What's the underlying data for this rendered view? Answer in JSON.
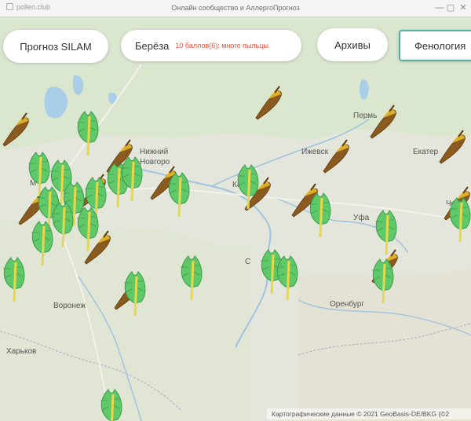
{
  "window": {
    "url": "pollen.club",
    "title": "Онлайн сообщество и АллергоПрогноз",
    "minimize_glyph": "—",
    "restore_glyph": "▢",
    "close_glyph": "✕"
  },
  "controls": {
    "silam_label": "Прогноз SILAM",
    "birch_label": "Берёза",
    "birch_note": "10 баллов(6): много пыльцы",
    "archive_label": "Архивы",
    "phenology_label": "Фенология"
  },
  "map": {
    "cities": {
      "moscow": "М",
      "nizhny1": "Нижний",
      "nizhny2": "Новгоро",
      "kazan": "Казань",
      "perm": "Пермь",
      "izhevsk": "Ижевск",
      "ekaterinburg": "Екатер",
      "ufa": "Уфа",
      "chelyabinsk": "Челя",
      "samara": "С",
      "voronezh": "Воронеж",
      "orenburg": "Оренбург",
      "kharkiv": "Харьков"
    },
    "attribution": "Картографические данные © 2021 GeoBasis-DE/BKG (©2"
  },
  "colors": {
    "leaf_green": "#5fc96a",
    "leaf_green_dark": "#3f9a4a",
    "catkin_brown": "#8a5a1e",
    "catkin_yellow": "#e7b92a",
    "accent_teal": "#4db3a0",
    "note_red": "#e5533a"
  }
}
